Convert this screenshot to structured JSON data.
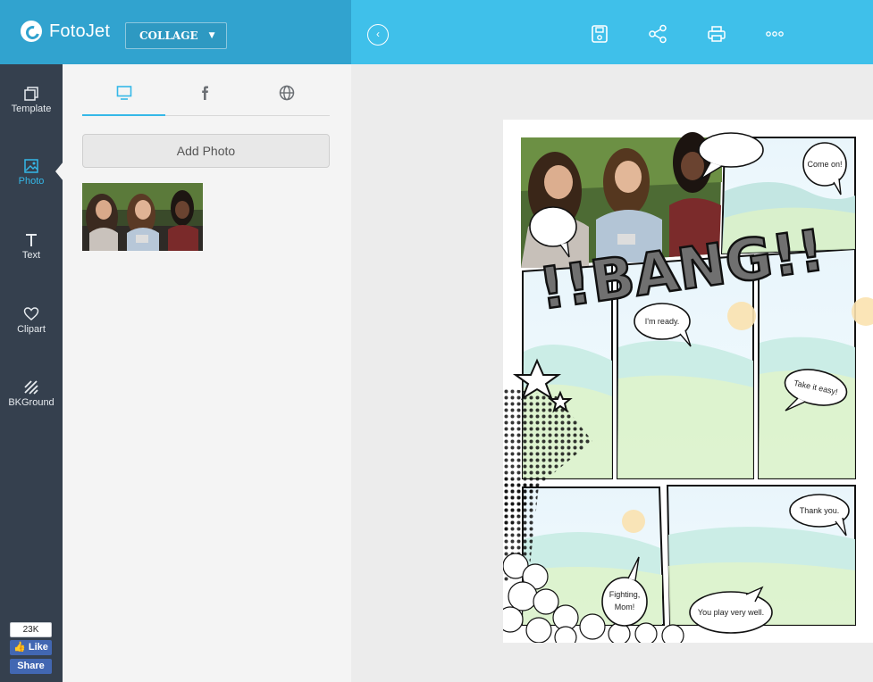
{
  "app": {
    "brand": "FotoJet",
    "mode_label": "COLLAGE",
    "colors": {
      "header_left": "#31a3cf",
      "header_right": "#3fc0ea",
      "rail": "#35404e",
      "accent": "#35b8e8"
    }
  },
  "toolbar": {
    "back_icon": "chevron-left-circle-icon",
    "items": [
      {
        "icon": "save-icon"
      },
      {
        "icon": "share-icon"
      },
      {
        "icon": "print-icon"
      },
      {
        "icon": "more-icon"
      }
    ]
  },
  "rail": {
    "items": [
      {
        "label": "Template",
        "icon": "template-icon"
      },
      {
        "label": "Photo",
        "icon": "photo-icon",
        "active": true
      },
      {
        "label": "Text",
        "icon": "text-icon"
      },
      {
        "label": "Clipart",
        "icon": "heart-icon"
      },
      {
        "label": "BKGround",
        "icon": "background-icon"
      }
    ],
    "social": {
      "count": "23K",
      "like_label": "Like",
      "share_label": "Share"
    }
  },
  "panel": {
    "source_tabs": [
      {
        "icon": "computer-icon",
        "active": true
      },
      {
        "icon": "facebook-icon"
      },
      {
        "icon": "globe-icon"
      }
    ],
    "add_photo_label": "Add Photo"
  },
  "comic": {
    "sound_effect": "!!BANG!!",
    "bubbles": [
      {
        "text": "Come on!"
      },
      {
        "text": "I'm ready."
      },
      {
        "text": "Take it easy!"
      },
      {
        "text": "Thank you."
      },
      {
        "text": "Fighting,"
      },
      {
        "text": "Mom!"
      },
      {
        "text": "You play very well."
      }
    ]
  }
}
